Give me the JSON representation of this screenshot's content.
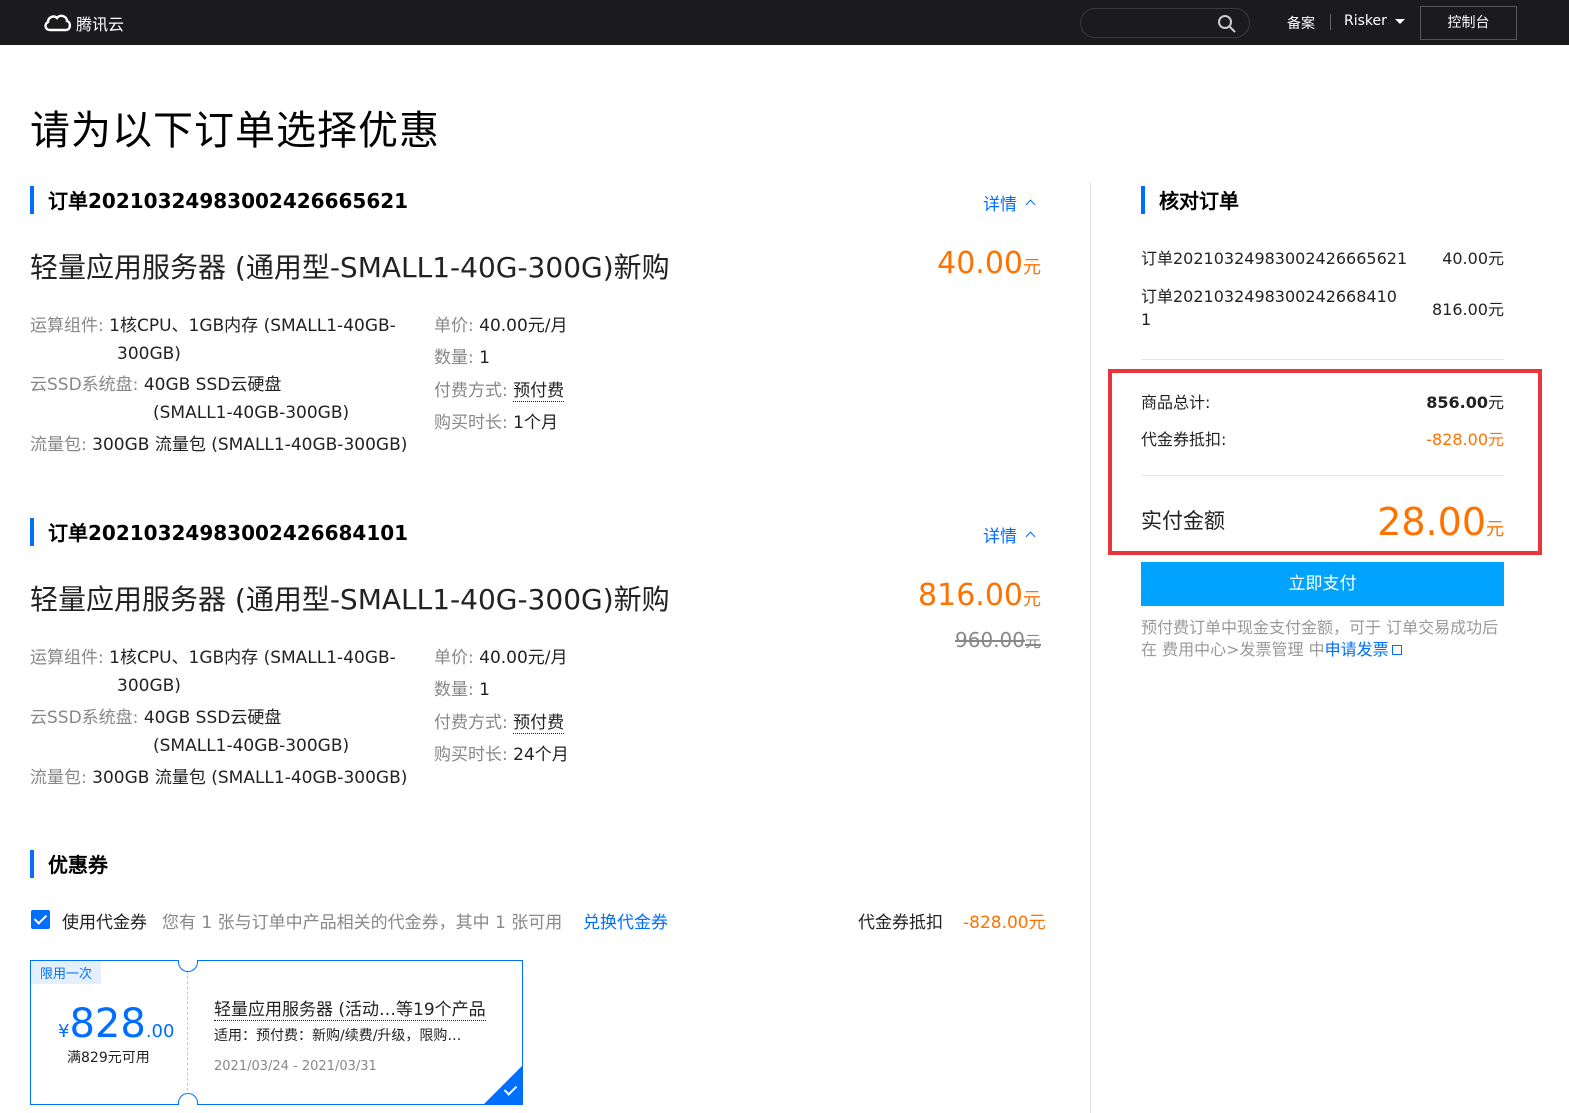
{
  "topbar": {
    "logo_text": "腾讯云",
    "search_placeholder": "",
    "beian": "备案",
    "user": "Risker",
    "console": "控制台"
  },
  "page_title": "请为以下订单选择优惠",
  "orders": [
    {
      "heading": "订单20210324983002426665621",
      "detail": "详情",
      "product": "轻量应用服务器 (通用型-SMALL1-40G-300G)新购",
      "price": "40.00",
      "price_unit": "元",
      "cpu_label": "运算组件:",
      "cpu_value_1": "1核CPU、1GB内存 (SMALL1-40GB-",
      "cpu_value_2": "300GB)",
      "disk_label": "云SSD系统盘:",
      "disk_value_1": "40GB SSD云硬盘",
      "disk_value_2": "(SMALL1-40GB-300GB)",
      "traffic_label": "流量包:",
      "traffic_value": "300GB 流量包 (SMALL1-40GB-300GB)",
      "unit_price_label": "单价:",
      "unit_price_value": "40.00元/月",
      "qty_label": "数量:",
      "qty_value": "1",
      "pay_label": "付费方式:",
      "pay_value": "预付费",
      "duration_label": "购买时长:",
      "duration_value": "1个月"
    },
    {
      "heading": "订单20210324983002426684101",
      "detail": "详情",
      "product": "轻量应用服务器 (通用型-SMALL1-40G-300G)新购",
      "price": "816.00",
      "price_unit": "元",
      "original_price": "960.00",
      "original_unit": "元",
      "cpu_label": "运算组件:",
      "cpu_value_1": "1核CPU、1GB内存 (SMALL1-40GB-",
      "cpu_value_2": "300GB)",
      "disk_label": "云SSD系统盘:",
      "disk_value_1": "40GB SSD云硬盘",
      "disk_value_2": "(SMALL1-40GB-300GB)",
      "traffic_label": "流量包:",
      "traffic_value": "300GB 流量包 (SMALL1-40GB-300GB)",
      "unit_price_label": "单价:",
      "unit_price_value": "40.00元/月",
      "qty_label": "数量:",
      "qty_value": "1",
      "pay_label": "付费方式:",
      "pay_value": "预付费",
      "duration_label": "购买时长:",
      "duration_value": "24个月"
    }
  ],
  "coupon": {
    "heading": "优惠券",
    "use_label": "使用代金券",
    "info": "您有 1 张与订单中产品相关的代金券，其中 1 张可用",
    "exchange": "兑换代金券",
    "deduct_label": "代金券抵扣",
    "deduct_value": "-828.00元",
    "voucher": {
      "tag": "限用一次",
      "currency": "¥",
      "amount": "828",
      "decimal": ".00",
      "condition": "满829元可用",
      "title": "轻量应用服务器 (活动…等19个产品",
      "desc": "适用：预付费：新购/续费/升级，限购…",
      "date": "2021/03/24 - 2021/03/31"
    }
  },
  "summary": {
    "heading": "核对订单",
    "order1_label": "订单20210324983002426665621",
    "order1_value": "40.00元",
    "order2_label_1": "订单2021032498300242668410",
    "order2_label_2": "1",
    "order2_value": "816.00元",
    "total_label": "商品总计:",
    "total_value": "856.00",
    "total_unit": "元",
    "deduct_label": "代金券抵扣:",
    "deduct_value": "-828.00元",
    "pay_label": "实付金额",
    "pay_value": "28.00",
    "pay_unit": "元",
    "pay_button": "立即支付",
    "note": "预付费订单中现金支付金额，可于 订单交易成功后 在 费用中心>发票管理 中",
    "note_link": "申请发票"
  },
  "colors": {
    "accent": "#006eff",
    "price": "#ff7200",
    "highlight": "#e8343a",
    "pay_button": "#00a4ff"
  }
}
